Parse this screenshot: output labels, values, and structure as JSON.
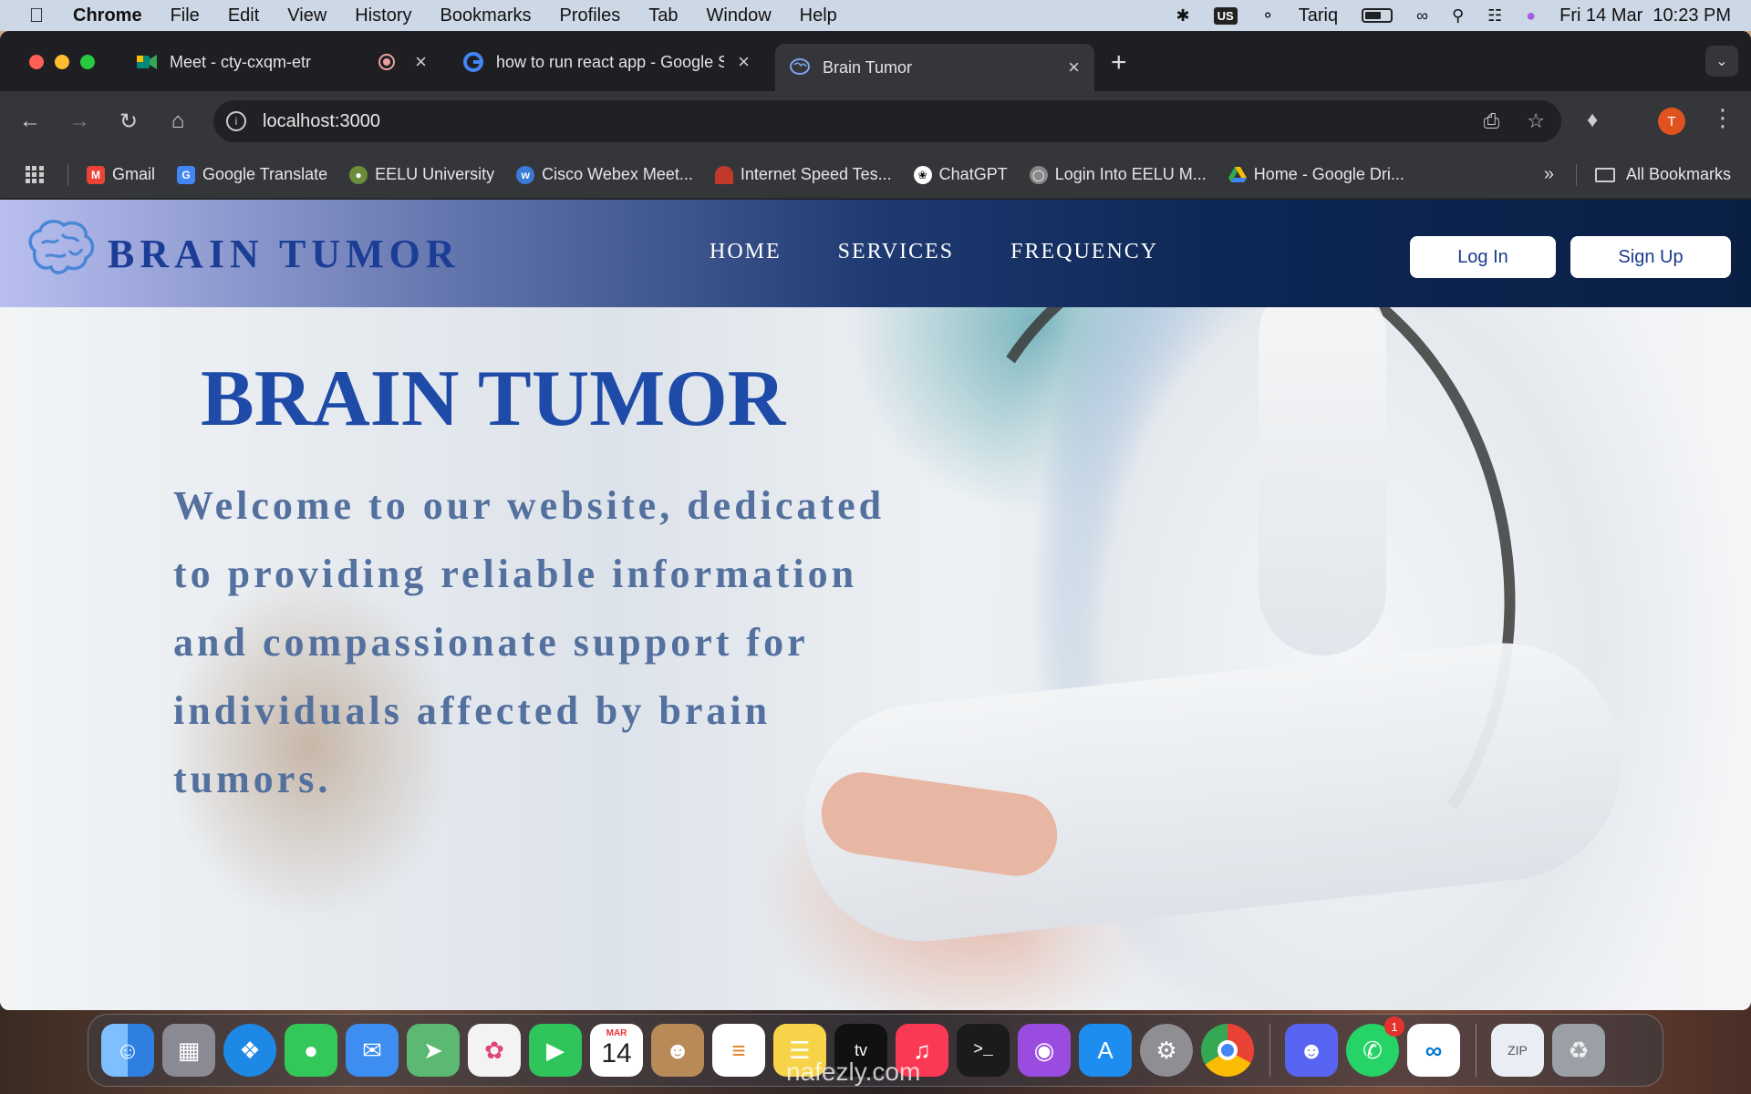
{
  "menubar": {
    "app_name": "Chrome",
    "items": [
      "File",
      "Edit",
      "View",
      "History",
      "Bookmarks",
      "Profiles",
      "Tab",
      "Window",
      "Help"
    ],
    "keyboard": "US",
    "user": "Tariq",
    "datetime": "Fri 14 Mar  10:23 PM"
  },
  "tabs": [
    {
      "title": "Meet - cty-cxqm-etr",
      "icon": "google-meet-icon",
      "recording": true
    },
    {
      "title": "how to run react app - Google Search",
      "icon": "google-icon"
    },
    {
      "title": "Brain Tumor",
      "icon": "brain-icon",
      "active": true
    }
  ],
  "toolbar": {
    "url": "localhost:3000"
  },
  "profile": {
    "initial": "T",
    "color": "#e0531f"
  },
  "bookmarks": {
    "items": [
      {
        "label": "Gmail",
        "icon": "gmail-icon",
        "color": "#ea4335"
      },
      {
        "label": "Google Translate",
        "icon": "translate-icon",
        "color": "#4285f4"
      },
      {
        "label": "EELU University",
        "icon": "university-icon",
        "color": "#6a8d3a"
      },
      {
        "label": "Cisco Webex Meet...",
        "icon": "webex-icon",
        "color": "#3a7bd5"
      },
      {
        "label": "Internet Speed Tes...",
        "icon": "speedtest-icon",
        "color": "#c0392b"
      },
      {
        "label": "ChatGPT",
        "icon": "chatgpt-icon",
        "color": "#111111"
      },
      {
        "label": "Login Into EELU M...",
        "icon": "globe-icon",
        "color": "#888888"
      },
      {
        "label": "Home - Google Dri...",
        "icon": "google-drive-icon",
        "color": "#f4b400"
      }
    ],
    "all_label": "All Bookmarks"
  },
  "site": {
    "brand": "BRAIN TUMOR",
    "nav": [
      "HOME",
      "SERVICES",
      "FREQUENCY"
    ],
    "login_label": "Log In",
    "signup_label": "Sign Up",
    "hero_title": "BRAIN TUMOR",
    "hero_text": "Welcome to our website, dedicated to providing reliable information and compassionate support for individuals affected by brain tumors.",
    "colors": {
      "brand_blue": "#1f4ba8",
      "nav_dark": "#0a1f44",
      "hero_text": "#53709e"
    }
  },
  "dock": {
    "apps": [
      {
        "name": "finder-icon",
        "color": "#3b8fe8"
      },
      {
        "name": "launchpad-icon",
        "color": "#8a8a95"
      },
      {
        "name": "safari-icon",
        "color": "#1e88e5"
      },
      {
        "name": "messages-icon",
        "color": "#34c759"
      },
      {
        "name": "mail-icon",
        "color": "#3d8ef0"
      },
      {
        "name": "maps-icon",
        "color": "#5bb974"
      },
      {
        "name": "photos-icon",
        "color": "#f3f3f3"
      },
      {
        "name": "facetime-icon",
        "color": "#2fc55a"
      },
      {
        "name": "calendar-icon",
        "color": "#ffffff"
      },
      {
        "name": "contacts-icon",
        "color": "#b88a57"
      },
      {
        "name": "reminders-icon",
        "color": "#ffffff"
      },
      {
        "name": "notes-icon",
        "color": "#f7d34a"
      },
      {
        "name": "apple-tv-icon",
        "color": "#111111"
      },
      {
        "name": "music-icon",
        "color": "#fa3a55"
      },
      {
        "name": "terminal-icon",
        "color": "#1b1b1b"
      },
      {
        "name": "podcasts-icon",
        "color": "#9b4ce0"
      },
      {
        "name": "app-store-icon",
        "color": "#1d8ef0"
      },
      {
        "name": "system-settings-icon",
        "color": "#8e8e93"
      },
      {
        "name": "chrome-icon",
        "color": "#ffffff"
      }
    ],
    "apps2": [
      {
        "name": "discord-icon",
        "color": "#5865f2"
      },
      {
        "name": "whatsapp-icon",
        "color": "#25d366",
        "badge": "1"
      },
      {
        "name": "vscode-icon",
        "color": "#ffffff"
      }
    ],
    "calendar": {
      "month": "MAR",
      "day": "14"
    },
    "terminal_prompt": ">_"
  },
  "watermark": "nafezly.com"
}
